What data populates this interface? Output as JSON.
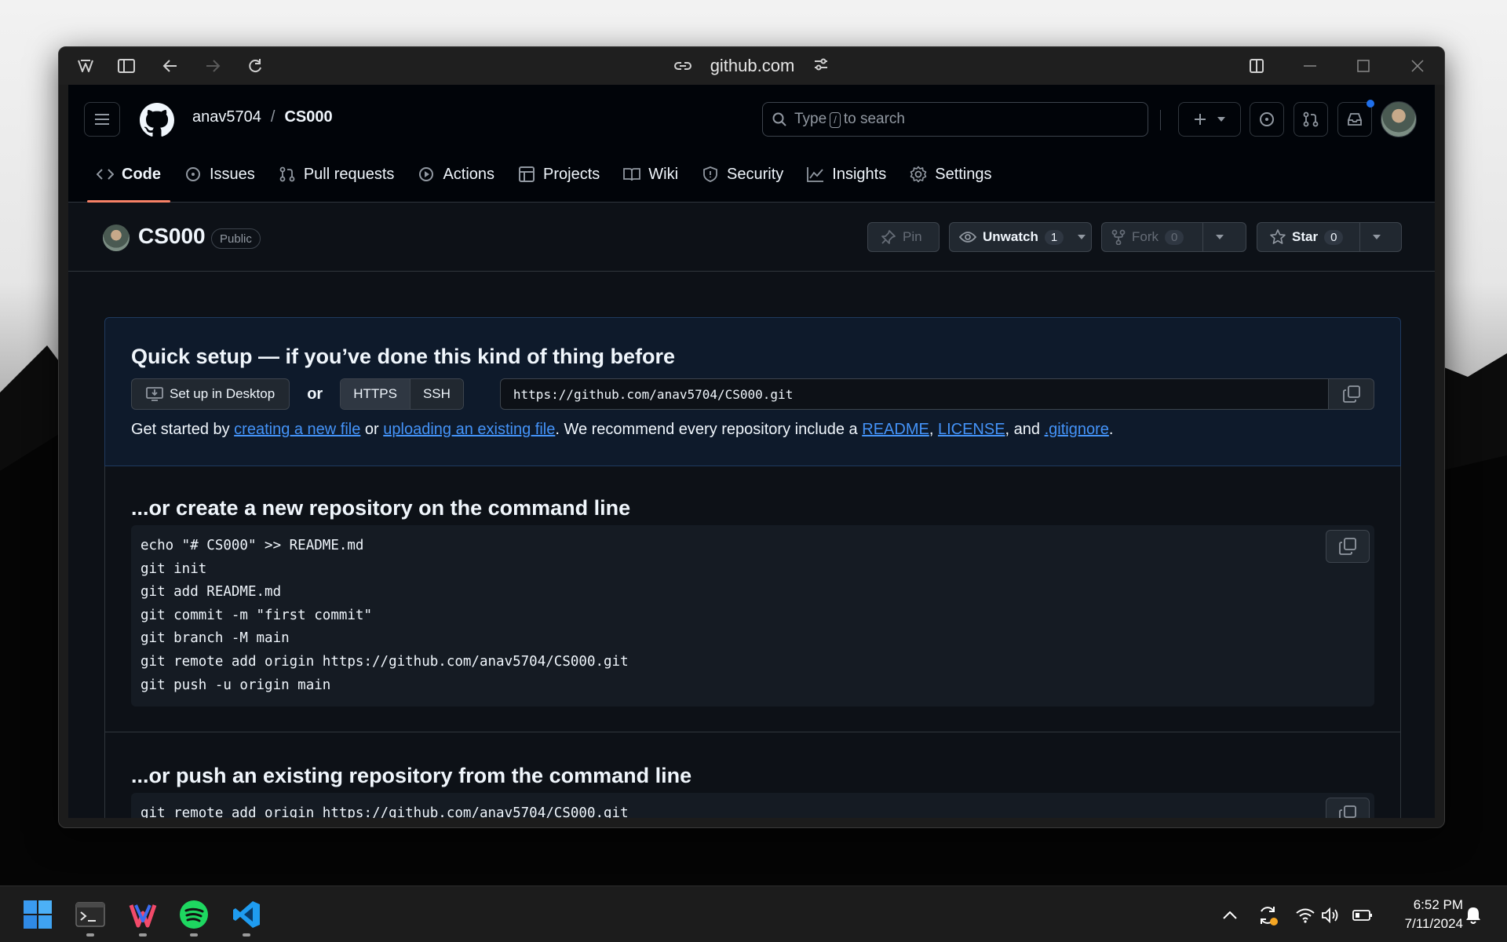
{
  "browser": {
    "url": "github.com"
  },
  "header": {
    "owner": "anav5704",
    "separator": "/",
    "repo": "CS000",
    "search_prefix": "Type",
    "search_key": "/",
    "search_suffix": "to search"
  },
  "nav": {
    "items": [
      {
        "label": "Code",
        "icon": "code-icon"
      },
      {
        "label": "Issues",
        "icon": "issue-opened-icon"
      },
      {
        "label": "Pull requests",
        "icon": "git-pull-request-icon"
      },
      {
        "label": "Actions",
        "icon": "play-icon"
      },
      {
        "label": "Projects",
        "icon": "table-icon"
      },
      {
        "label": "Wiki",
        "icon": "book-icon"
      },
      {
        "label": "Security",
        "icon": "shield-icon"
      },
      {
        "label": "Insights",
        "icon": "graph-icon"
      },
      {
        "label": "Settings",
        "icon": "gear-icon"
      }
    ]
  },
  "repo": {
    "name": "CS000",
    "visibility": "Public",
    "pin_label": "Pin",
    "watch_label": "Unwatch",
    "watch_count": "1",
    "fork_label": "Fork",
    "fork_count": "0",
    "star_label": "Star",
    "star_count": "0"
  },
  "quick_setup": {
    "title": "Quick setup — if you’ve done this kind of thing before",
    "desktop_label": "Set up in Desktop",
    "or_label": "or",
    "https_label": "HTTPS",
    "ssh_label": "SSH",
    "clone_url": "https://github.com/anav5704/CS000.git",
    "gs_prefix": "Get started by ",
    "gs_link1": "creating a new file",
    "gs_mid1": " or ",
    "gs_link2": "uploading an existing file",
    "gs_mid2": ". We recommend every repository include a ",
    "gs_link3": "README",
    "gs_comma1": ", ",
    "gs_link4": "LICENSE",
    "gs_mid3": ", and ",
    "gs_link5": ".gitignore",
    "gs_end": "."
  },
  "new_repo": {
    "title": "...or create a new repository on the command line",
    "lines": [
      "echo \"# CS000\" >> README.md",
      "git init",
      "git add README.md",
      "git commit -m \"first commit\"",
      "git branch -M main",
      "git remote add origin https://github.com/anav5704/CS000.git",
      "git push -u origin main"
    ]
  },
  "push_existing": {
    "title": "...or push an existing repository from the command line",
    "lines": [
      "git remote add origin https://github.com/anav5704/CS000.git"
    ]
  },
  "taskbar": {
    "time": "6:52 PM",
    "date": "7/11/2024"
  },
  "colors": {
    "accent": "#4493f8",
    "tab_underline": "#f78166",
    "notification_dot": "#1f6feb"
  }
}
